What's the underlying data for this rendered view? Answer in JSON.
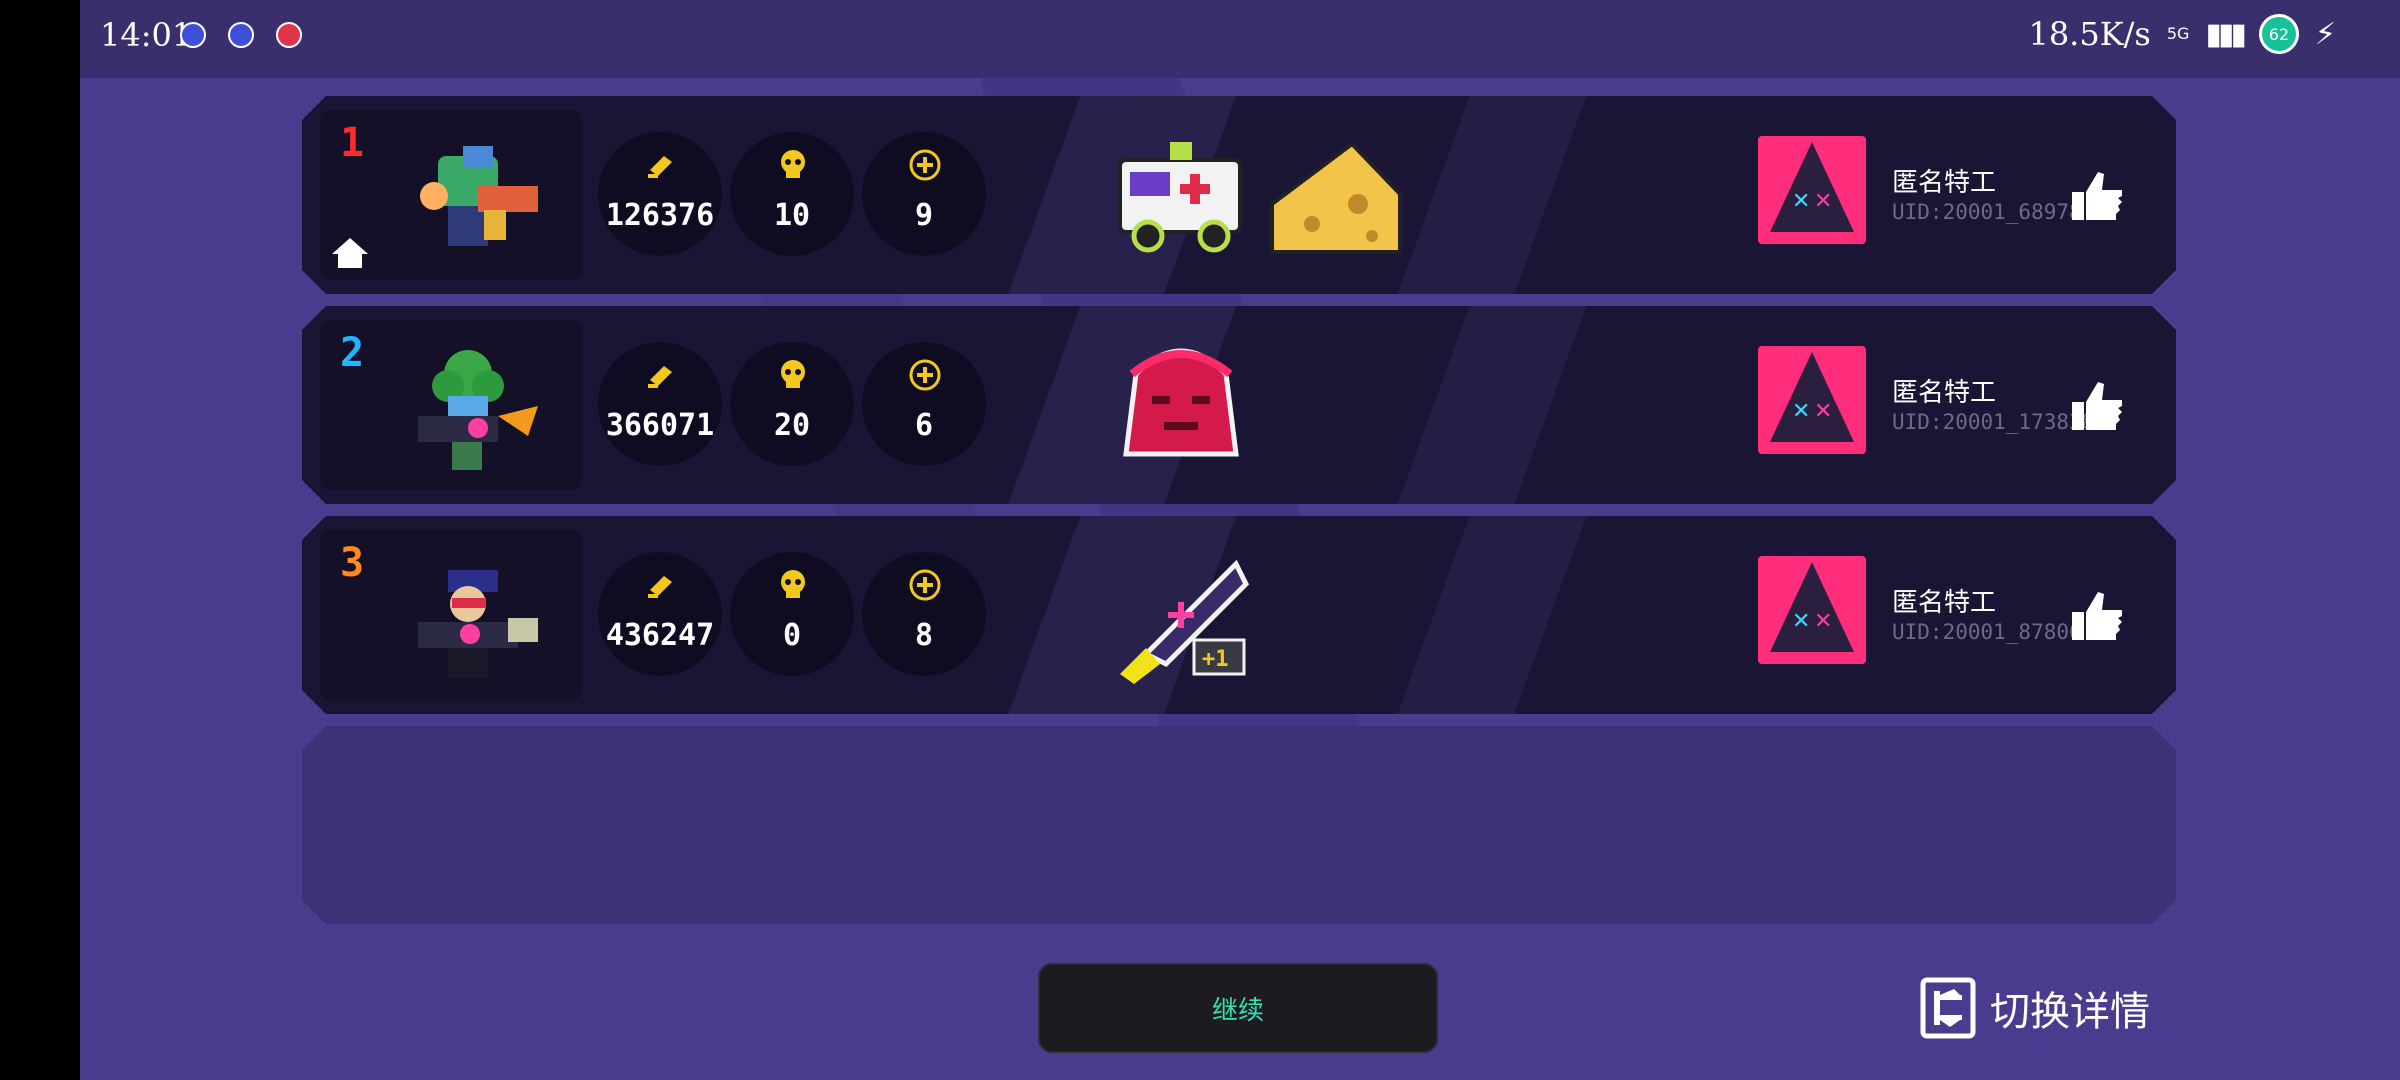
{
  "status_bar": {
    "time": "14:01",
    "net_speed": "18.5K/s",
    "network": "5G",
    "battery": "62"
  },
  "players": [
    {
      "rank": "1",
      "rank_color": "#ff2a2a",
      "is_self": true,
      "coins": "126376",
      "kills": "10",
      "heals": "9",
      "items": [
        "ambulance",
        "cheese"
      ],
      "name": "匿名特工",
      "uid": "UID:20001_68978"
    },
    {
      "rank": "2",
      "rank_color": "#1eb7ff",
      "is_self": false,
      "coins": "366071",
      "kills": "20",
      "heals": "6",
      "items": [
        "demon"
      ],
      "name": "匿名特工",
      "uid": "UID:20001_173838"
    },
    {
      "rank": "3",
      "rank_color": "#ff8a1e",
      "is_self": false,
      "coins": "436247",
      "kills": "0",
      "heals": "8",
      "items": [
        "rocket"
      ],
      "rocket_badge": "+1",
      "name": "匿名特工",
      "uid": "UID:20001_87806"
    }
  ],
  "continue_label": "继续",
  "switch_label": "切换详情",
  "colors": {
    "accent_yellow": "#f2c81c",
    "accent_teal": "#32e0b4",
    "panel_dark": "#1a1535",
    "background": "#4a3b8e"
  }
}
